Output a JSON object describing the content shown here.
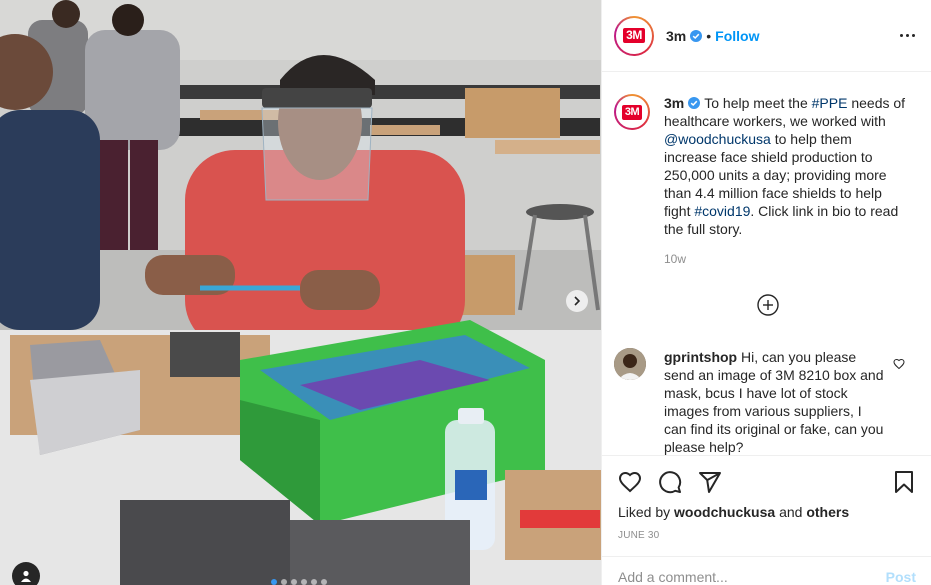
{
  "post": {
    "username": "3m",
    "brand_logo_text": "3M",
    "follow_separator": "•",
    "follow_label": "Follow",
    "more_icon": "more-horizontal-icon",
    "caption": {
      "username": "3m",
      "text_1": "To help meet the ",
      "hashtag_1": "#PPE",
      "text_2": " needs of healthcare workers, we worked with ",
      "mention": "@woodchuckusa",
      "text_3": " to help them increase face shield production to 250,000 units a day; providing more than 4.4 million face shields to help fight ",
      "hashtag_2": "#covid19",
      "text_4": ". Click link in bio to read the full story.",
      "time": "10w"
    },
    "load_more_icon": "plus-circle-icon",
    "comment": {
      "username": "gprintshop",
      "text": "Hi, can you please send an image of 3M 8210 box and mask, bcus I have lot of stock images from various suppliers, I can find its original or fake, can you please help?"
    },
    "likes": {
      "prefix": "Liked by ",
      "user": "woodchuckusa",
      "middle": " and ",
      "others": "others"
    },
    "date": "JUNE 30",
    "add_comment_placeholder": "Add a comment...",
    "post_label": "Post"
  },
  "carousel": {
    "slide_count": 6,
    "active_index": 0
  },
  "colors": {
    "accent": "#0095f6",
    "brand_red": "#e4002b",
    "link": "#00376b",
    "muted": "#8e8e8e"
  }
}
